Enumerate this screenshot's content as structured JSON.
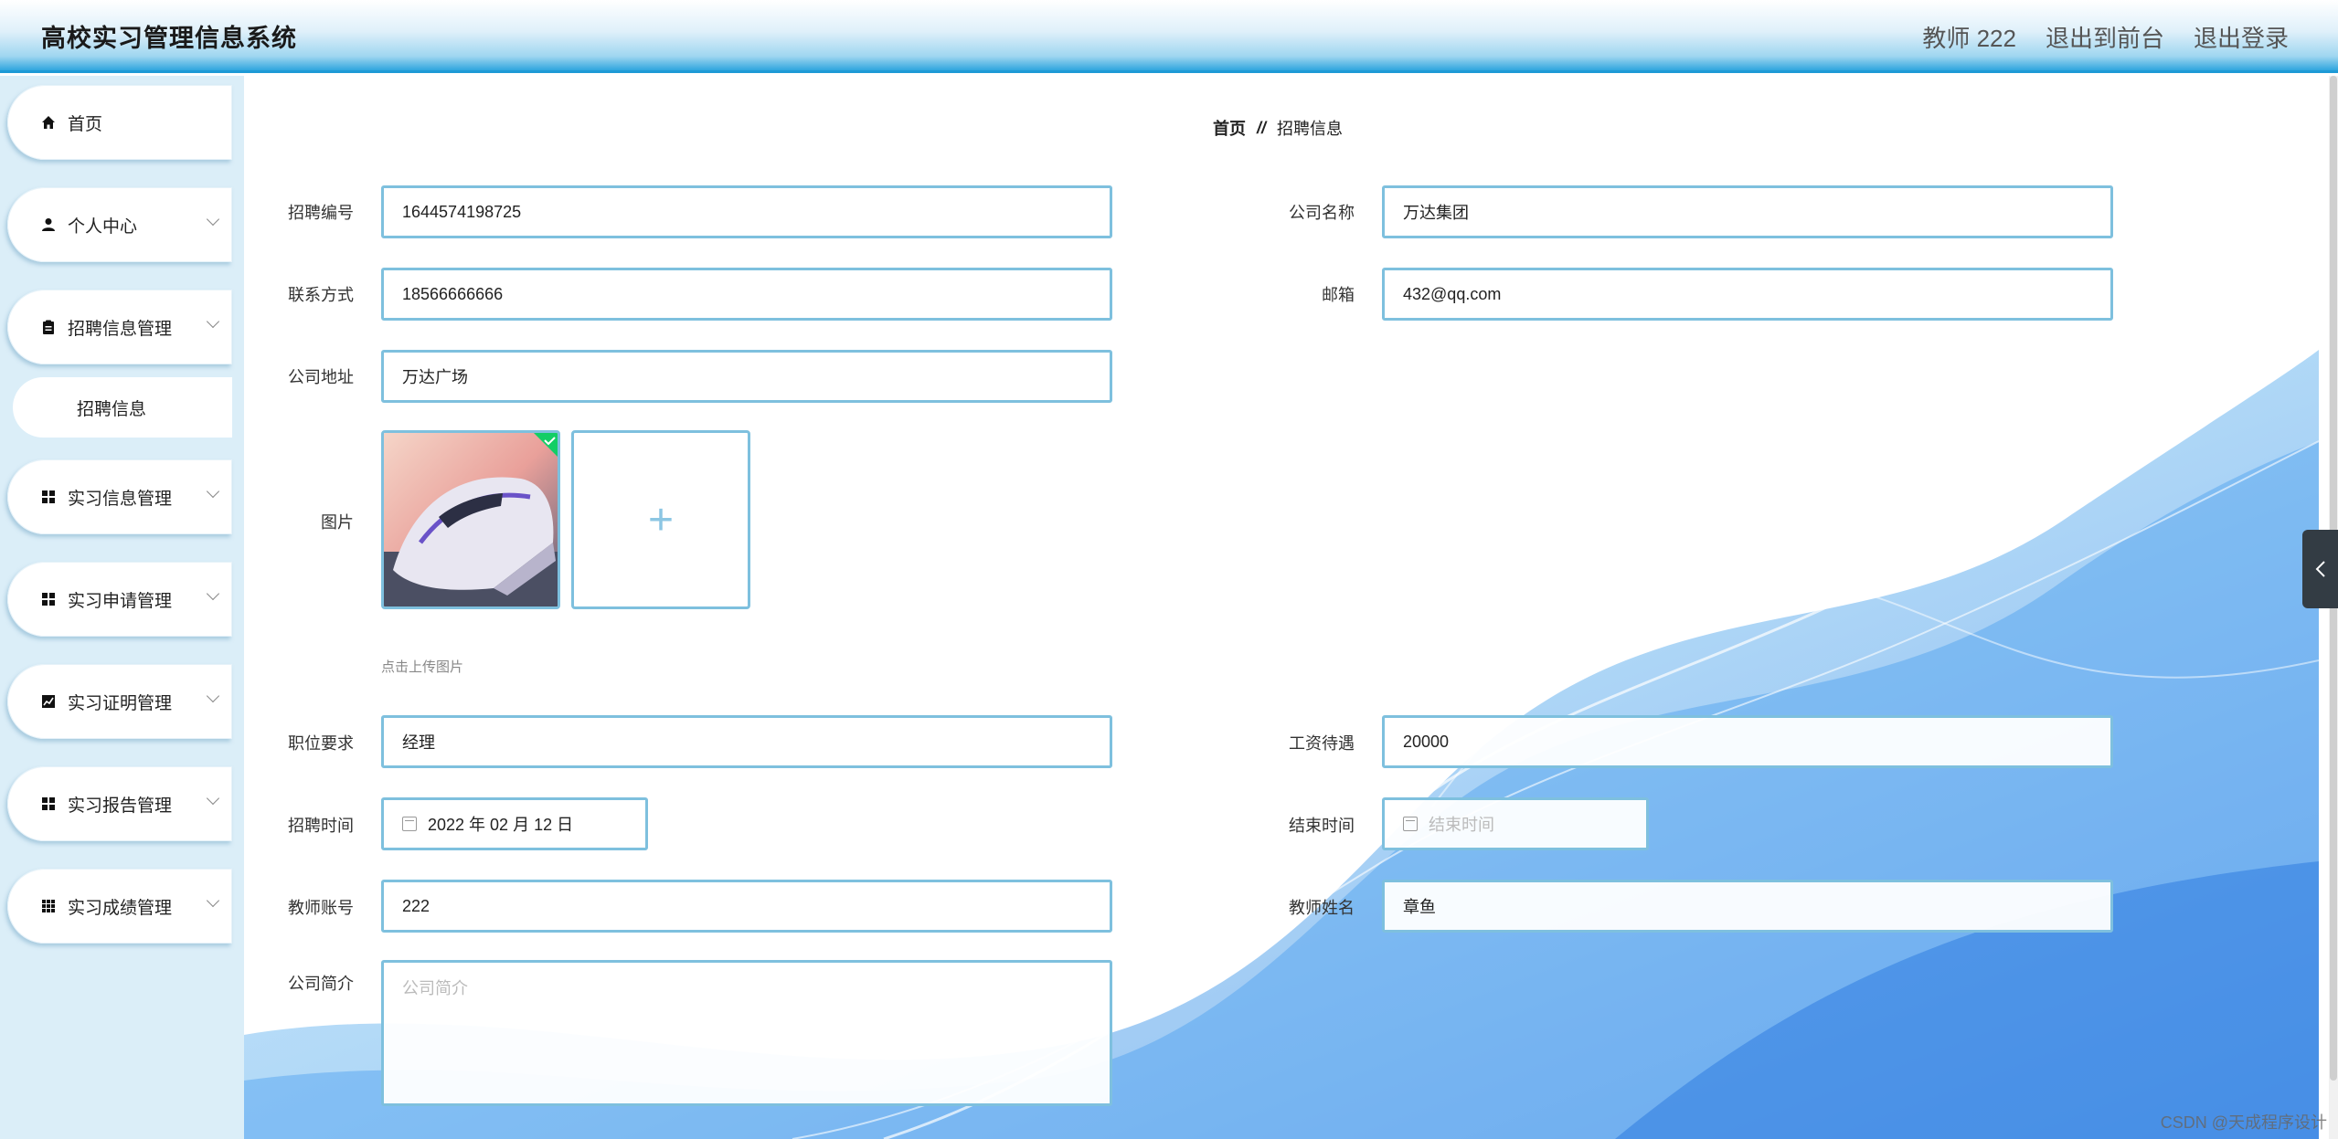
{
  "header": {
    "title": "高校实习管理信息系统",
    "user": "教师 222",
    "back_front": "退出到前台",
    "logout": "退出登录"
  },
  "sidebar": {
    "items": [
      {
        "label": "首页",
        "icon": "home-icon"
      },
      {
        "label": "个人中心",
        "icon": "user-icon"
      },
      {
        "label": "招聘信息管理",
        "icon": "clipboard-icon"
      },
      {
        "label": "招聘信息",
        "icon": ""
      },
      {
        "label": "实习信息管理",
        "icon": "grid-icon"
      },
      {
        "label": "实习申请管理",
        "icon": "grid-icon"
      },
      {
        "label": "实习证明管理",
        "icon": "chart-icon"
      },
      {
        "label": "实习报告管理",
        "icon": "grid-icon"
      },
      {
        "label": "实习成绩管理",
        "icon": "grid9-icon"
      }
    ]
  },
  "breadcrumb": {
    "home": "首页",
    "sep": "//",
    "current": "招聘信息"
  },
  "form": {
    "recruit_no": {
      "label": "招聘编号",
      "value": "1644574198725"
    },
    "company_name": {
      "label": "公司名称",
      "value": "万达集团"
    },
    "contact": {
      "label": "联系方式",
      "value": "18566666666"
    },
    "email": {
      "label": "邮箱",
      "value": "432@qq.com"
    },
    "address": {
      "label": "公司地址",
      "value": "万达广场"
    },
    "image": {
      "label": "图片",
      "hint": "点击上传图片",
      "add": "+"
    },
    "position": {
      "label": "职位要求",
      "value": "经理"
    },
    "salary": {
      "label": "工资待遇",
      "value": "20000"
    },
    "recruit_time": {
      "label": "招聘时间",
      "value": "2022 年 02 月 12 日"
    },
    "end_time": {
      "label": "结束时间",
      "placeholder": "结束时间"
    },
    "teacher_account": {
      "label": "教师账号",
      "value": "222"
    },
    "teacher_name": {
      "label": "教师姓名",
      "value": "章鱼"
    },
    "intro": {
      "label": "公司简介",
      "placeholder": "公司简介"
    }
  },
  "watermark": "CSDN @天成程序设计",
  "colors": {
    "accent": "#1e9ad6",
    "input_border": "#7ec0de"
  }
}
